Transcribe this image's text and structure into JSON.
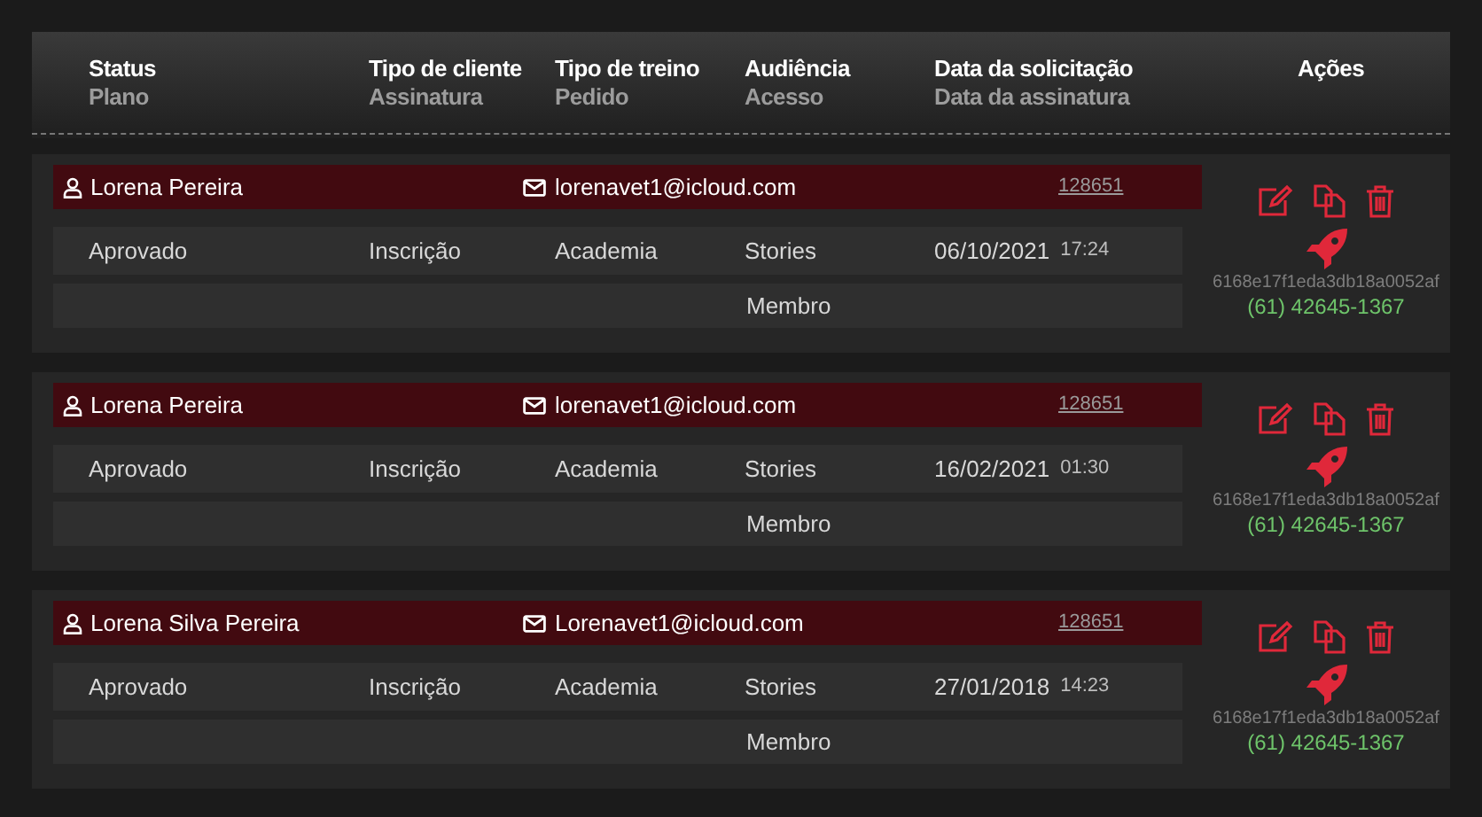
{
  "header": {
    "columns": [
      {
        "top": "Status",
        "bottom": "Plano"
      },
      {
        "top": "Tipo de cliente",
        "bottom": "Assinatura"
      },
      {
        "top": "Tipo de treino",
        "bottom": "Pedido"
      },
      {
        "top": "Audiência",
        "bottom": "Acesso"
      },
      {
        "top": "Data da solicitação",
        "bottom": "Data da assinatura"
      }
    ],
    "actions": "Ações"
  },
  "records": [
    {
      "name": "Lorena Pereira",
      "email": "lorenavet1@icloud.com",
      "code": "128651",
      "status": "Aprovado",
      "client_type": "Inscrição",
      "training_type": "Academia",
      "audience": "Stories",
      "date": "06/10/2021",
      "time": "17:24",
      "access": "Membro",
      "id": "6168e17f1eda3db18a0052af",
      "phone": "(61) 42645-1367"
    },
    {
      "name": "Lorena Pereira",
      "email": "lorenavet1@icloud.com",
      "code": "128651",
      "status": "Aprovado",
      "client_type": "Inscrição",
      "training_type": "Academia",
      "audience": "Stories",
      "date": "16/02/2021",
      "time": "01:30",
      "access": "Membro",
      "id": "6168e17f1eda3db18a0052af",
      "phone": "(61) 42645-1367"
    },
    {
      "name": "Lorena Silva Pereira",
      "email": "Lorenavet1@icloud.com",
      "code": "128651",
      "status": "Aprovado",
      "client_type": "Inscrição",
      "training_type": "Academia",
      "audience": "Stories",
      "date": "27/01/2018",
      "time": "14:23",
      "access": "Membro",
      "id": "6168e17f1eda3db18a0052af",
      "phone": "(61) 42645-1367"
    }
  ]
}
